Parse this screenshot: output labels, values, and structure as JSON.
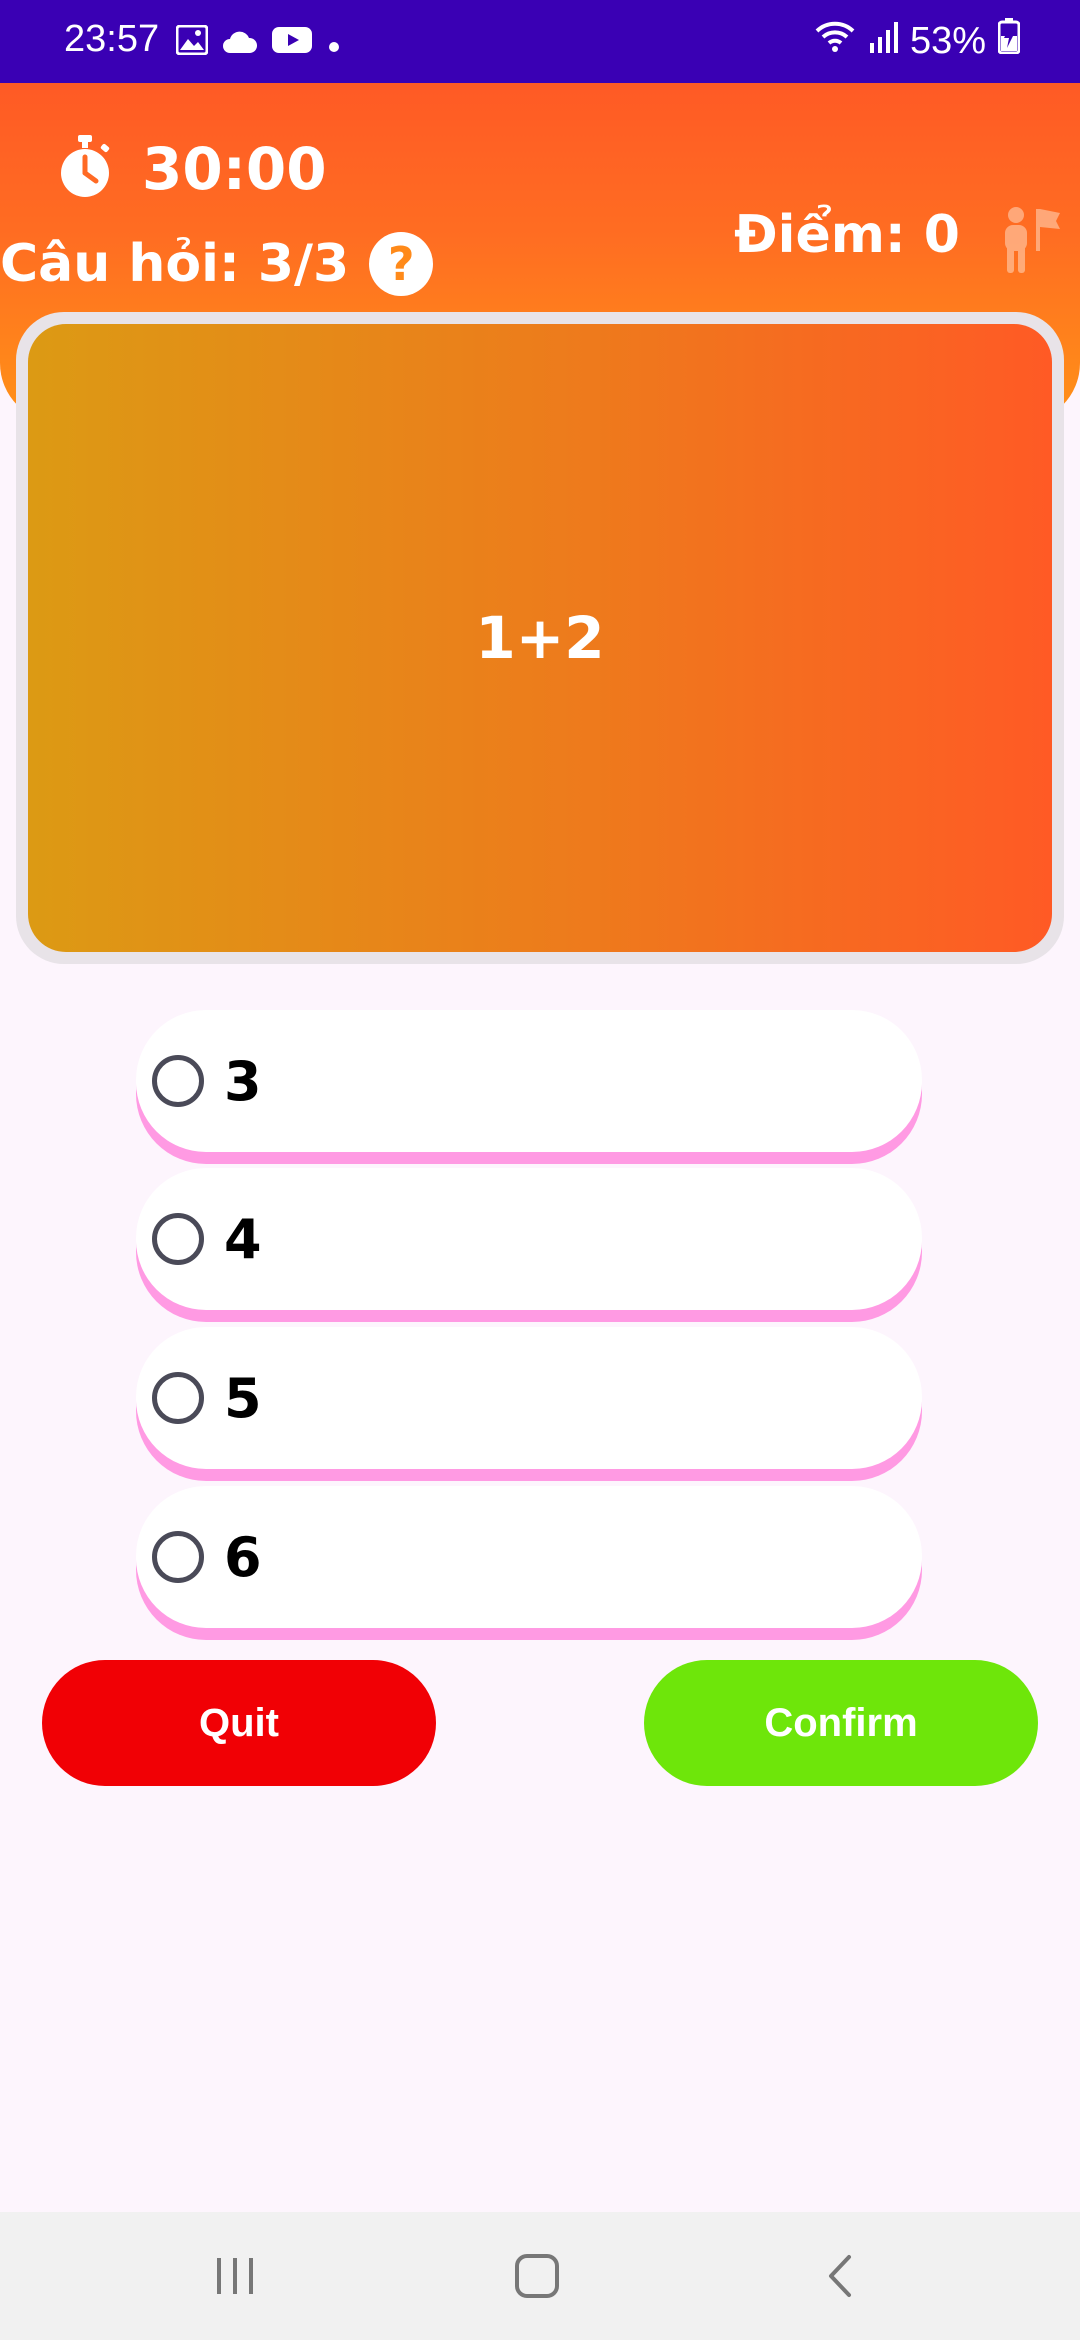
{
  "status_bar": {
    "time": "23:57",
    "battery": "53%",
    "icons": [
      "gallery-icon",
      "cloud-icon",
      "youtube-icon",
      "dot-icon",
      "wifi-icon",
      "signal-icon",
      "battery-icon"
    ]
  },
  "header": {
    "timer": "30:00",
    "question_counter": "Câu hỏi: 3/3",
    "help": "?",
    "score": "Điểm: 0"
  },
  "question": {
    "text": "1+2"
  },
  "options": [
    {
      "label": "3",
      "selected": false
    },
    {
      "label": "4",
      "selected": false
    },
    {
      "label": "5",
      "selected": false
    },
    {
      "label": "6",
      "selected": false
    }
  ],
  "buttons": {
    "quit": "Quit",
    "confirm": "Confirm"
  },
  "colors": {
    "status_bar": "#3a00b4",
    "header_top": "#ff5a25",
    "header_bottom": "#ff9217",
    "quit": "#f10005",
    "confirm": "#6ee60a",
    "option_shadow": "#ff9ae3"
  }
}
